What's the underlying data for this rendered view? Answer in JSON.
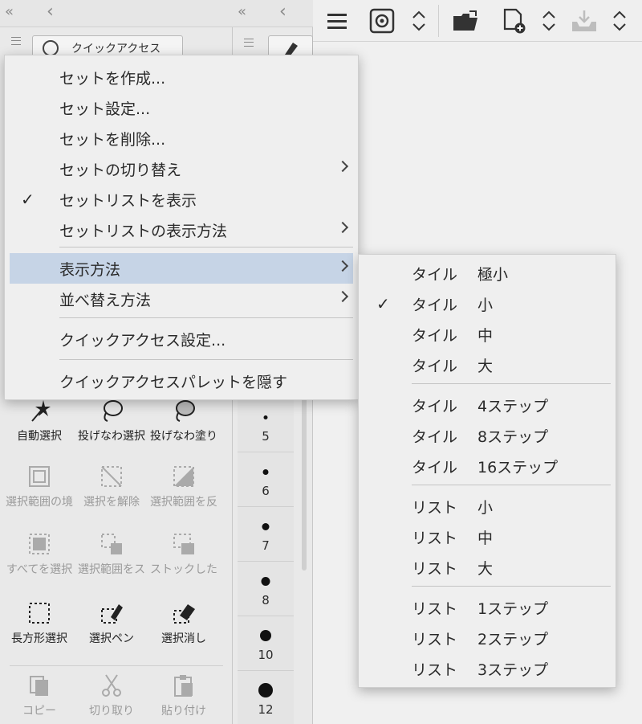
{
  "left_panel": {
    "collapse_glyph": "«",
    "back_glyph": "‹",
    "tab_label": "クイックアクセス"
  },
  "brush_panel": {
    "collapse_glyph": "«",
    "back_glyph": "‹",
    "sizes": [
      "5",
      "6",
      "7",
      "8",
      "10",
      "12"
    ]
  },
  "tools": [
    {
      "label": "自動選択",
      "icon": "magic-wand-icon",
      "dim": false
    },
    {
      "label": "投げなわ選択",
      "icon": "lasso-icon",
      "dim": false
    },
    {
      "label": "投げなわ塗り",
      "icon": "lasso-fill-icon",
      "dim": false
    },
    {
      "label": "選択範囲の境",
      "icon": "selection-border-icon",
      "dim": true
    },
    {
      "label": "選択を解除",
      "icon": "deselect-icon",
      "dim": true
    },
    {
      "label": "選択範囲を反",
      "icon": "invert-selection-icon",
      "dim": true
    },
    {
      "label": "すべてを選択",
      "icon": "select-all-icon",
      "dim": true
    },
    {
      "label": "選択範囲をス",
      "icon": "store-selection-icon",
      "dim": true
    },
    {
      "label": "ストックした",
      "icon": "stocked-selection-icon",
      "dim": true
    },
    {
      "label": "長方形選択",
      "icon": "rectangle-select-icon",
      "dim": false
    },
    {
      "label": "選択ペン",
      "icon": "selection-pen-icon",
      "dim": false
    },
    {
      "label": "選択消し",
      "icon": "selection-eraser-icon",
      "dim": false
    },
    {
      "label": "コピー",
      "icon": "copy-icon",
      "dim": true
    },
    {
      "label": "切り取り",
      "icon": "scissors-icon",
      "dim": true
    },
    {
      "label": "貼り付け",
      "icon": "paste-icon",
      "dim": true
    }
  ],
  "main_menu": {
    "items": [
      {
        "label": "セットを作成...",
        "checked": false,
        "submenu": false
      },
      {
        "label": "セット設定...",
        "checked": false,
        "submenu": false
      },
      {
        "label": "セットを削除...",
        "checked": false,
        "submenu": false
      },
      {
        "label": "セットの切り替え",
        "checked": false,
        "submenu": true
      },
      {
        "label": "セットリストを表示",
        "checked": true,
        "submenu": false
      },
      {
        "label": "セットリストの表示方法",
        "checked": false,
        "submenu": true
      },
      {
        "label": "表示方法",
        "checked": false,
        "submenu": true,
        "highlighted": true
      },
      {
        "label": "並べ替え方法",
        "checked": false,
        "submenu": true
      },
      {
        "label": "クイックアクセス設定...",
        "checked": false,
        "submenu": false
      },
      {
        "label": "クイックアクセスパレットを隠す",
        "checked": false,
        "submenu": false
      }
    ],
    "check_glyph": "✓"
  },
  "sub_menu": {
    "items": [
      {
        "a": "タイル",
        "b": "極小",
        "checked": false
      },
      {
        "a": "タイル",
        "b": "小",
        "checked": true
      },
      {
        "a": "タイル",
        "b": "中",
        "checked": false
      },
      {
        "a": "タイル",
        "b": "大",
        "checked": false
      },
      {
        "a": "タイル",
        "b": "4ステップ",
        "checked": false
      },
      {
        "a": "タイル",
        "b": "8ステップ",
        "checked": false
      },
      {
        "a": "タイル",
        "b": "16ステップ",
        "checked": false
      },
      {
        "a": "リスト",
        "b": "小",
        "checked": false
      },
      {
        "a": "リスト",
        "b": "中",
        "checked": false
      },
      {
        "a": "リスト",
        "b": "大",
        "checked": false
      },
      {
        "a": "リスト",
        "b": "1ステップ",
        "checked": false
      },
      {
        "a": "リスト",
        "b": "2ステップ",
        "checked": false
      },
      {
        "a": "リスト",
        "b": "3ステップ",
        "checked": false
      }
    ]
  },
  "colors": {
    "highlight": "#c6d4e6",
    "menu_bg": "#efefef",
    "panel_bg": "#e9e9e9"
  }
}
